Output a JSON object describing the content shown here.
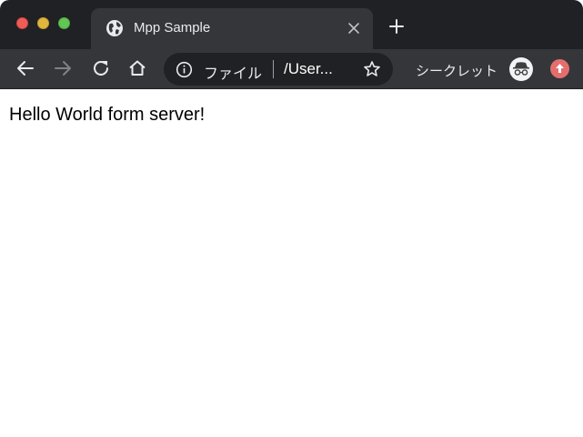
{
  "tab": {
    "title": "Mpp Sample",
    "favicon": "globe-icon"
  },
  "omnibox": {
    "scheme_label": "ファイル",
    "url": "/User..."
  },
  "profile": {
    "label": "シークレット",
    "avatar": "incognito-icon"
  },
  "page": {
    "text": "Hello World form server!"
  },
  "colors": {
    "frame": "#202124",
    "toolbar": "#35363a",
    "update_badge": "#e46e6e"
  }
}
